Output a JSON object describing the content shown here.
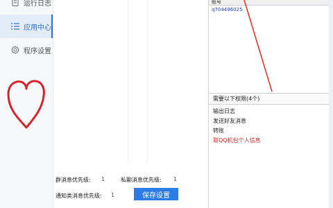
{
  "sidebar": {
    "items": [
      {
        "label": "运行日志",
        "icon": "log-icon"
      },
      {
        "label": "应用中心",
        "icon": "list-icon",
        "active": true
      },
      {
        "label": "程序设置",
        "icon": "gear-icon"
      }
    ]
  },
  "settings": {
    "group_priority_label": "群消息优先级:",
    "group_priority_value": "1",
    "private_priority_label": "私聊消息优先级:",
    "private_priority_value": "1",
    "notice_priority_label": "通知类消息优先级:",
    "notice_priority_value": "1",
    "save_label": "保存设置"
  },
  "right": {
    "header": "账号",
    "account": "q704496025",
    "perm_header": "需要以下权限(4个)",
    "permissions": [
      {
        "label": "输出日志",
        "color": "#222222"
      },
      {
        "label": "发送好友消息",
        "color": "#222222"
      },
      {
        "label": "转账",
        "color": "#222222"
      },
      {
        "label": "取QQ机包个人信息",
        "color": "#e32020"
      }
    ]
  },
  "colors": {
    "accent": "#2d7be5",
    "active_nav": "#2f6fd8",
    "warning_red": "#e32020",
    "annotation_red": "#e8332b",
    "heart_red": "#d9232a"
  }
}
